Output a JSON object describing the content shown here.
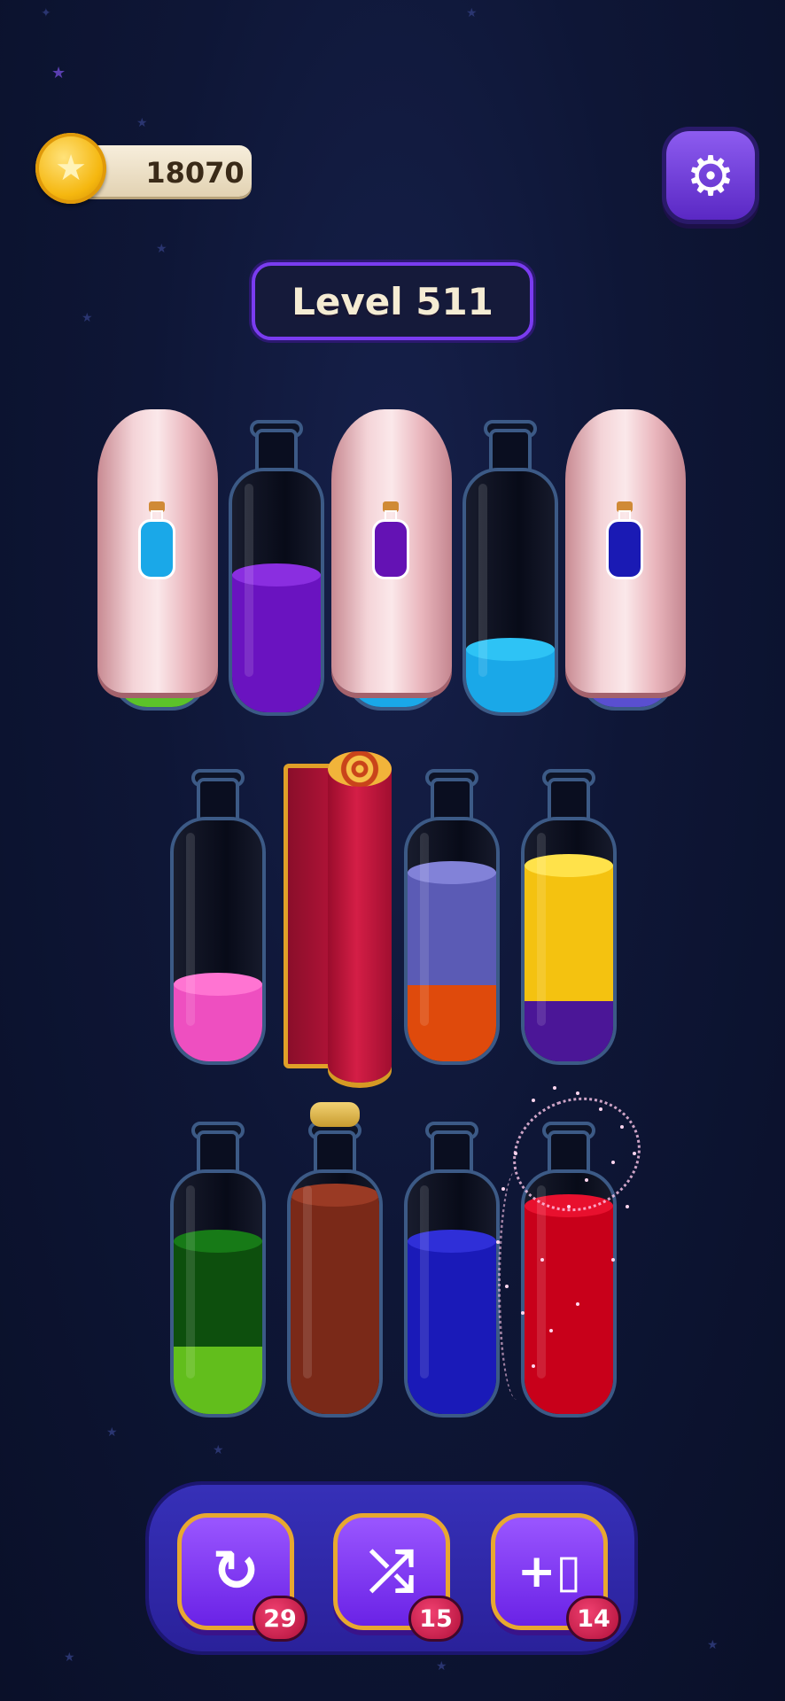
{
  "hud": {
    "coins": "18070",
    "level": "Level 511",
    "settings_icon": "gear-icon",
    "coin_icon": "star-coin-icon"
  },
  "toolbar": {
    "undo": {
      "icon": "undo-icon",
      "count": "29"
    },
    "shuffle": {
      "icon": "shuffle-icon",
      "count": "15"
    },
    "add_bottle": {
      "icon": "add-bottle-icon",
      "count": "14"
    }
  },
  "bottles": {
    "row1": [
      {
        "covered": true,
        "hint_color": "#1aa8e8",
        "visible_bottom": "#5cc229"
      },
      {
        "covered": false,
        "layers": [
          "#6a13c0",
          "#6a13c0",
          "#6a13c0"
        ]
      },
      {
        "covered": true,
        "hint_color": "#6412b4",
        "visible_bottom": "#1aa8e8"
      },
      {
        "covered": false,
        "layers": [
          "#1aa8e8"
        ]
      },
      {
        "covered": true,
        "hint_color": "#1a1ab4",
        "visible_bottom": "#5a4fd0"
      }
    ],
    "row2": [
      {
        "covered": false,
        "layers": [
          "#ee4fc0"
        ]
      },
      {
        "covered": "scroll"
      },
      {
        "covered": false,
        "layers": [
          "#df4a0c",
          "#5b5bb5"
        ]
      },
      {
        "covered": false,
        "layers": [
          "#4b1697",
          "#f4c210",
          "#f4c210"
        ]
      }
    ],
    "row3": [
      {
        "covered": false,
        "layers": [
          "#62be1c",
          "#0d4f0d"
        ]
      },
      {
        "covered": false,
        "corked": true,
        "layers": [
          "#7a2918",
          "#7a2918",
          "#7a2918"
        ]
      },
      {
        "covered": false,
        "layers": [
          "#1a1ab8",
          "#1a1ab8"
        ]
      },
      {
        "covered": false,
        "sparkling": true,
        "layers": [
          "#c8001a",
          "#c8001a",
          "#c8001a"
        ]
      }
    ]
  }
}
